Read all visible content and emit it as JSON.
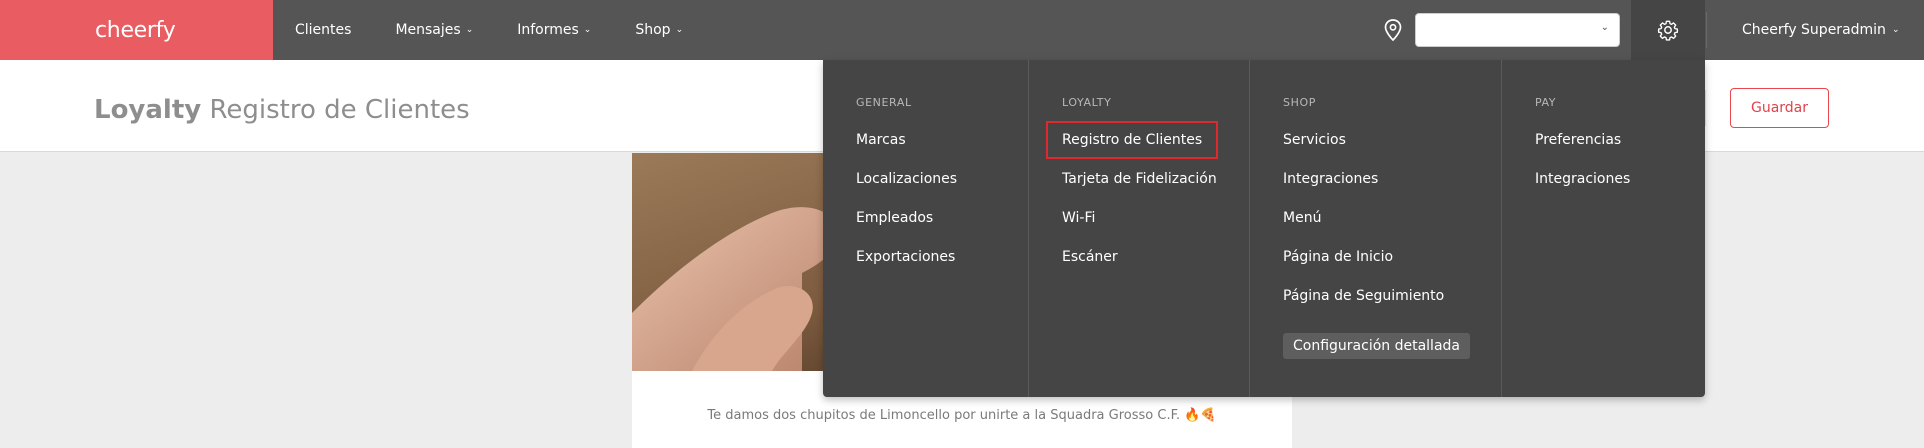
{
  "brand": {
    "name": "cheerfy",
    "color": "#e95c61"
  },
  "nav": [
    {
      "label": "Clientes",
      "has_caret": false
    },
    {
      "label": "Mensajes",
      "has_caret": true
    },
    {
      "label": "Informes",
      "has_caret": true
    },
    {
      "label": "Shop",
      "has_caret": true
    }
  ],
  "location_select": {
    "value": ""
  },
  "user": {
    "name": "Cheerfy Superadmin"
  },
  "icons": {
    "location": "location-pin-icon",
    "settings": "gear-icon",
    "caret": "chevron-down-icon"
  },
  "page": {
    "title_bold": "Loyalty",
    "title_rest": "Registro de Clientes",
    "save_label": "Guardar"
  },
  "card": {
    "caption": "Te damos dos chupitos de Limoncello por unirte a la Squadra Grosso C.F. 🔥🍕"
  },
  "settings_menu": {
    "general": {
      "heading": "GENERAL",
      "items": [
        "Marcas",
        "Localizaciones",
        "Empleados",
        "Exportaciones"
      ]
    },
    "loyalty": {
      "heading": "LOYALTY",
      "items": [
        "Registro de Clientes",
        "Tarjeta de Fidelización",
        "Wi-Fi",
        "Escáner"
      ],
      "active_item": "Registro de Clientes"
    },
    "shop": {
      "heading": "SHOP",
      "items": [
        "Servicios",
        "Integraciones",
        "Menú",
        "Página de Inicio",
        "Página de Seguimiento"
      ],
      "detail_button": "Configuración detallada"
    },
    "pay": {
      "heading": "PAY",
      "items": [
        "Preferencias",
        "Integraciones"
      ]
    }
  },
  "colors": {
    "nav_bg": "#555555",
    "menu_bg": "#454545",
    "accent_red": "#e0434a",
    "highlight_border": "#e0292f"
  }
}
